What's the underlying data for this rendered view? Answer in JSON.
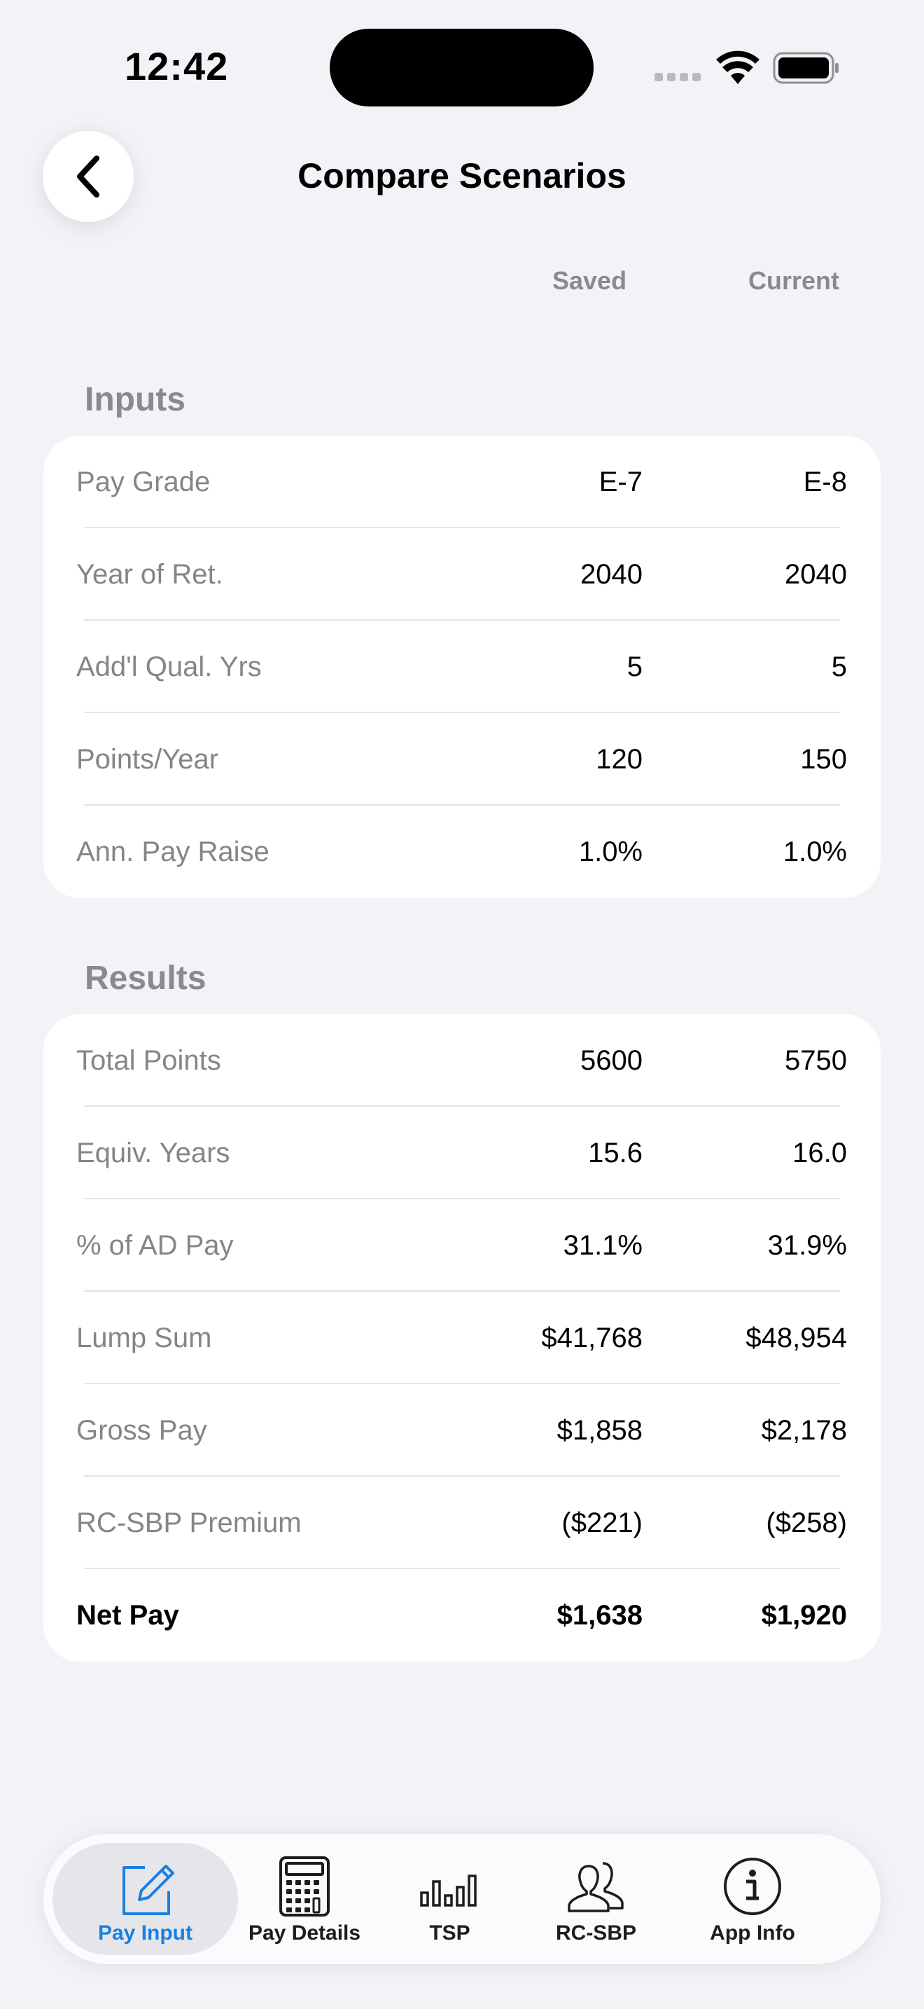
{
  "status": {
    "time": "12:42"
  },
  "header": {
    "title": "Compare Scenarios"
  },
  "columns": {
    "saved": "Saved",
    "current": "Current"
  },
  "inputs": {
    "title": "Inputs",
    "rows": [
      {
        "label": "Pay Grade",
        "saved": "E-7",
        "current": "E-8"
      },
      {
        "label": "Year of Ret.",
        "saved": "2040",
        "current": "2040"
      },
      {
        "label": "Add'l Qual. Yrs",
        "saved": "5",
        "current": "5"
      },
      {
        "label": "Points/Year",
        "saved": "120",
        "current": "150"
      },
      {
        "label": "Ann. Pay Raise",
        "saved": "1.0%",
        "current": "1.0%"
      }
    ]
  },
  "results": {
    "title": "Results",
    "rows": [
      {
        "label": "Total Points",
        "saved": "5600",
        "current": "5750"
      },
      {
        "label": "Equiv. Years",
        "saved": "15.6",
        "current": "16.0"
      },
      {
        "label": "% of AD Pay",
        "saved": "31.1%",
        "current": "31.9%"
      },
      {
        "label": "Lump Sum",
        "saved": "$41,768",
        "current": "$48,954"
      },
      {
        "label": "Gross Pay",
        "saved": "$1,858",
        "current": "$2,178"
      },
      {
        "label": "RC-SBP Premium",
        "saved": "($221)",
        "current": "($258)"
      },
      {
        "label": "Net Pay",
        "saved": "$1,638",
        "current": "$1,920"
      }
    ]
  },
  "tabbar": {
    "accent_color": "#1a7fe0",
    "tabs": [
      {
        "label": "Pay Input",
        "icon": "edit-icon",
        "active": true
      },
      {
        "label": "Pay Details",
        "icon": "calculator-icon",
        "active": false
      },
      {
        "label": "TSP",
        "icon": "bar-chart-icon",
        "active": false
      },
      {
        "label": "RC-SBP",
        "icon": "people-icon",
        "active": false
      },
      {
        "label": "App Info",
        "icon": "info-icon",
        "active": false
      }
    ]
  }
}
